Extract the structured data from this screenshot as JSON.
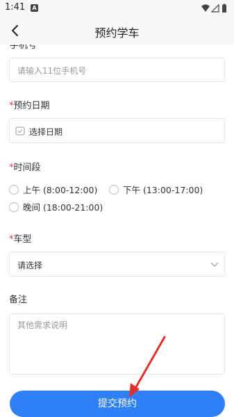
{
  "status_bar": {
    "time": "1:41",
    "notification_letter": "A"
  },
  "nav": {
    "title": "预约学车"
  },
  "form": {
    "phone": {
      "label_partial": "手机号",
      "placeholder": "请输入11位手机号"
    },
    "date": {
      "required_mark": "*",
      "label": "预约日期",
      "placeholder": "选择日期"
    },
    "time_slot": {
      "required_mark": "*",
      "label": "时间段",
      "options": [
        "上午 (8:00-12:00)",
        "下午 (13:00-17:00)",
        "晚间 (18:00-21:00)"
      ]
    },
    "car_type": {
      "required_mark": "*",
      "label": "车型",
      "placeholder": "请选择"
    },
    "remarks": {
      "label": "备注",
      "placeholder": "其他需求说明"
    }
  },
  "submit_label": "提交预约",
  "colors": {
    "accent": "#2f7ff5",
    "required": "#e53935",
    "arrow": "#e0302b"
  }
}
